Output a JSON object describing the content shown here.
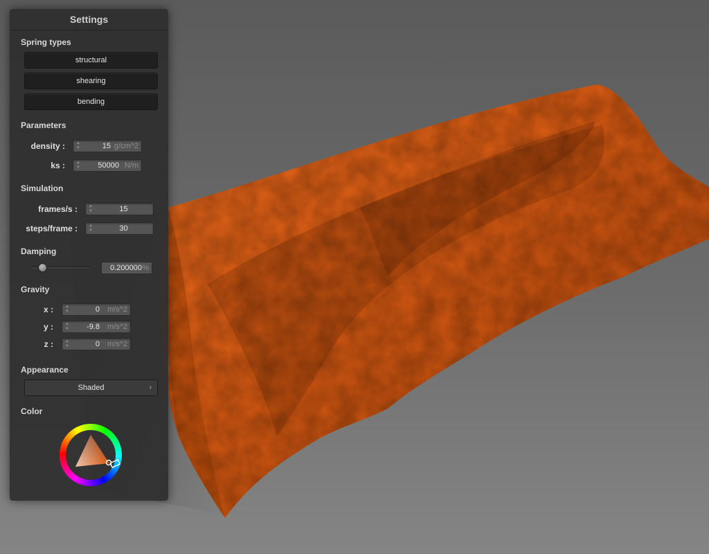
{
  "panel": {
    "title": "Settings"
  },
  "spring_types": {
    "label": "Spring types",
    "buttons": [
      "structural",
      "shearing",
      "bending"
    ]
  },
  "parameters": {
    "label": "Parameters",
    "density": {
      "label": "density :",
      "value": "15",
      "unit": "g/cm^2"
    },
    "ks": {
      "label": "ks :",
      "value": "50000",
      "unit": "N/m"
    }
  },
  "simulation": {
    "label": "Simulation",
    "frames_per_s": {
      "label": "frames/s :",
      "value": "15"
    },
    "steps_per_frame": {
      "label": "steps/frame :",
      "value": "30"
    }
  },
  "damping": {
    "label": "Damping",
    "value": "0.200000",
    "unit": "%",
    "slider_fraction": 0.2
  },
  "gravity": {
    "label": "Gravity",
    "x": {
      "label": "x :",
      "value": "0",
      "unit": "m/s^2"
    },
    "y": {
      "label": "y :",
      "value": "-9.8",
      "unit": "m/s^2"
    },
    "z": {
      "label": "z :",
      "value": "0",
      "unit": "m/s^2"
    }
  },
  "appearance": {
    "label": "Appearance",
    "selected": "Shaded"
  },
  "color": {
    "label": "Color",
    "value": "#e05a10"
  },
  "icons": {
    "spinner": "up-down-arrows-icon",
    "chevron": "chevron-right-icon"
  }
}
